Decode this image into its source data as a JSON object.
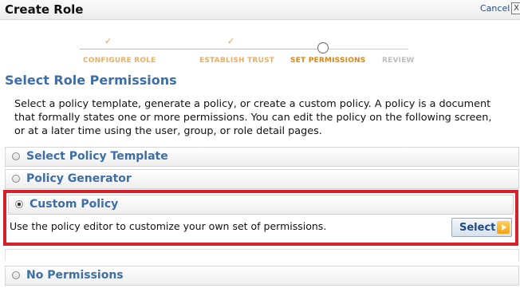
{
  "header": {
    "title": "Create Role",
    "cancel_label": "Cancel",
    "close_label": "X"
  },
  "wizard": {
    "steps": [
      {
        "label": "CONFIGURE ROLE",
        "state": "done"
      },
      {
        "label": "ESTABLISH TRUST",
        "state": "done"
      },
      {
        "label": "SET PERMISSIONS",
        "state": "current"
      },
      {
        "label": "REVIEW",
        "state": "todo"
      }
    ],
    "check_glyph": "✓"
  },
  "section_title": "Select Role Permissions",
  "description": "Select a policy template, generate a policy, or create a custom policy. A policy is a document that formally states one or more permissions. You can edit the policy on the following screen, or at a later time using the user, group, or role detail pages.",
  "options": [
    {
      "label": "Select Policy Template",
      "selected": false
    },
    {
      "label": "Policy Generator",
      "selected": false
    },
    {
      "label": "Custom Policy",
      "selected": true,
      "description": "Use the policy editor to customize your own set of permissions.",
      "button_label": "Select"
    },
    {
      "label": "No Permissions",
      "selected": false
    }
  ],
  "colors": {
    "accent_text": "#3d6ea6",
    "highlight_border": "#d8202a",
    "step_done": "#e6b06a",
    "step_current": "#d9861e",
    "step_todo": "#bdbdbd"
  },
  "icons": {
    "close": "close-icon",
    "check": "checkmark-icon",
    "current_step": "circle-icon",
    "select_arrow": "play-arrow-icon"
  }
}
